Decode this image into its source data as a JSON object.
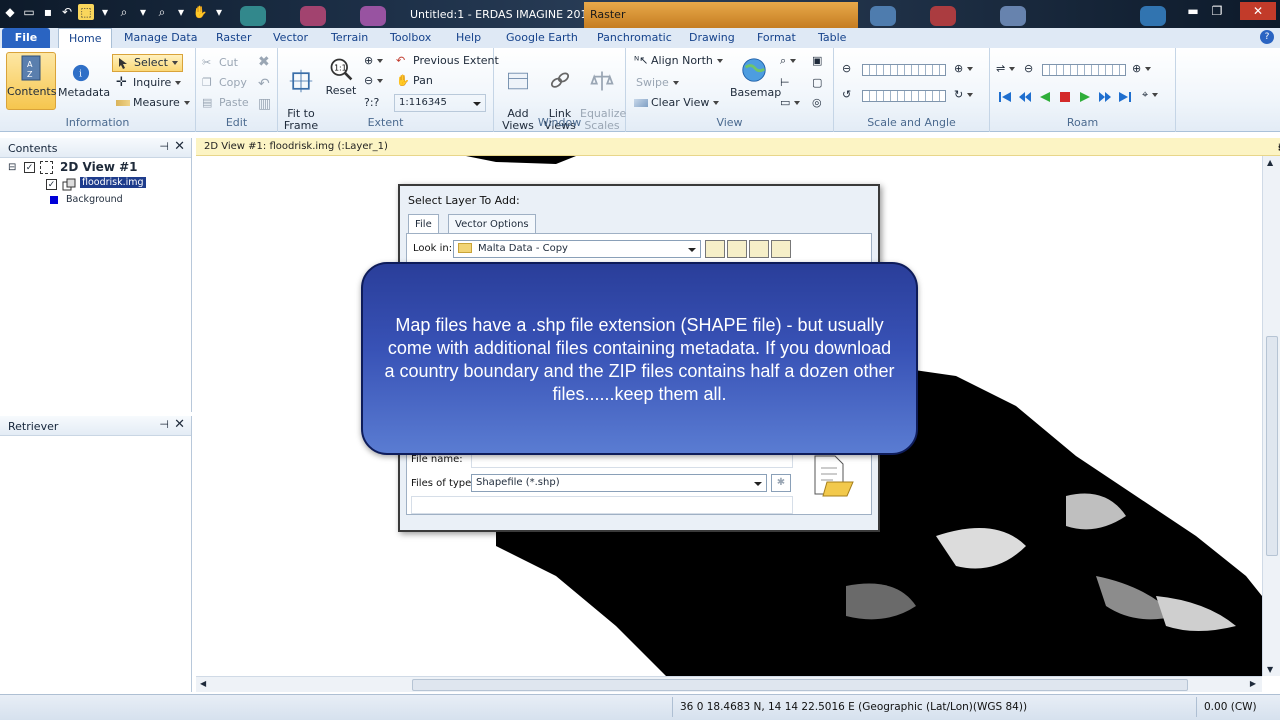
{
  "titlebar": {
    "title": "Untitled:1 - ERDAS IMAGINE 2011",
    "context_tab": "Raster"
  },
  "tabs": {
    "file": "File",
    "items": [
      "Home",
      "Manage Data",
      "Raster",
      "Vector",
      "Terrain",
      "Toolbox",
      "Help",
      "Google Earth",
      "Panchromatic",
      "Drawing",
      "Format",
      "Table"
    ]
  },
  "ribbon": {
    "information": {
      "label": "Information",
      "contents": "Contents",
      "metadata": "Metadata",
      "select": "Select",
      "inquire": "Inquire",
      "measure": "Measure"
    },
    "edit": {
      "label": "Edit",
      "cut": "Cut",
      "copy": "Copy",
      "paste": "Paste"
    },
    "extent": {
      "label": "Extent",
      "fit_to_frame": "Fit to\nFrame",
      "reset": "Reset",
      "previous_extent": "Previous Extent",
      "pan": "Pan",
      "scale_prefix": "?:?",
      "scale": "1:116345"
    },
    "window": {
      "label": "Window",
      "add_views": "Add\nViews",
      "link_views": "Link\nViews",
      "equalize_scales": "Equalize\nScales"
    },
    "view": {
      "label": "View",
      "align_north": "Align North",
      "swipe": "Swipe",
      "clear_view": "Clear View",
      "basemap": "Basemap"
    },
    "scale_angle": {
      "label": "Scale and Angle"
    },
    "roam": {
      "label": "Roam"
    }
  },
  "contents_panel": {
    "title": "Contents",
    "view_name": "2D View #1",
    "layer_name": "floodrisk.img",
    "background": "Background",
    "background_color": "#0000d8"
  },
  "retriever_panel": {
    "title": "Retriever"
  },
  "view": {
    "title": "2D View #1: floodrisk.img (:Layer_1)"
  },
  "dialog": {
    "title": "Select Layer To Add:",
    "tab_file": "File",
    "tab_vector_options": "Vector Options",
    "look_in_label": "Look in:",
    "look_in_value": "Malta Data - Copy",
    "file_name_label": "File name:",
    "file_name_value": "",
    "files_of_type_label": "Files of type:",
    "files_of_type_value": "Shapefile (*.shp)"
  },
  "callout": {
    "text": "Map files have a .shp file extension (SHAPE file) - but usually come with additional files containing metadata. If you download a country boundary and the ZIP files contains half a dozen other files......keep them all."
  },
  "statusbar": {
    "coordinates": "36  0 18.4683 N,  14 14 22.5016 E (Geographic (Lat/Lon)(WGS 84))",
    "rotation": "0.00 (CW)"
  },
  "colors": {
    "file_tab": "#2a64c2",
    "callout": "#3852b6",
    "view_title_bar": "#fcf4c4"
  }
}
